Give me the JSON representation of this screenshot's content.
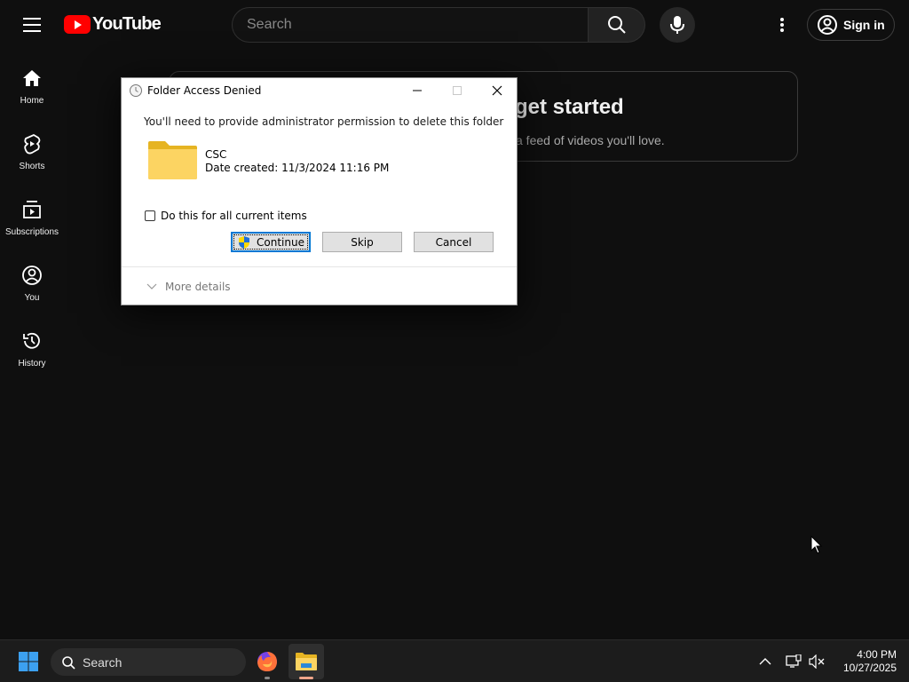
{
  "youtube": {
    "logo_text": "YouTube",
    "search_placeholder": "Search",
    "signin_label": "Sign in",
    "sidebar": [
      {
        "label": "Home",
        "icon": "home-icon"
      },
      {
        "label": "Shorts",
        "icon": "shorts-icon"
      },
      {
        "label": "Subscriptions",
        "icon": "subscriptions-icon"
      },
      {
        "label": "You",
        "icon": "you-icon"
      },
      {
        "label": "History",
        "icon": "history-icon"
      }
    ],
    "promo": {
      "title_visible": "get started",
      "subtitle_visible": "a feed of videos you'll love."
    },
    "colors": {
      "background": "#0f0f0f",
      "brand_red": "#ff0000"
    }
  },
  "dialog": {
    "title": "Folder Access Denied",
    "message": "You'll need to provide administrator permission to delete this folder",
    "item_name": "CSC",
    "item_date": "Date created: 11/3/2024 11:16 PM",
    "checkbox_label": "Do this for all current items",
    "checkbox_checked": false,
    "buttons": {
      "continue": "Continue",
      "skip": "Skip",
      "cancel": "Cancel"
    },
    "more_details": "More details"
  },
  "taskbar": {
    "search_label": "Search",
    "apps": [
      {
        "name": "firefox-icon"
      },
      {
        "name": "file-explorer-icon",
        "active": true
      }
    ],
    "time": "4:00 PM",
    "date": "10/27/2025"
  }
}
